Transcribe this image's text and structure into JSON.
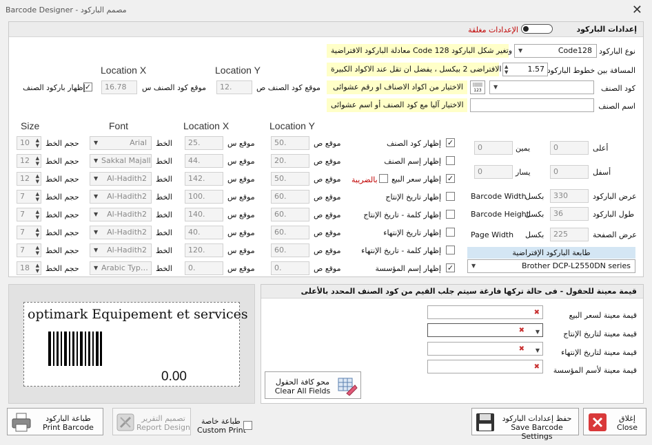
{
  "window": {
    "title": "Barcode Designer - مصمم الباركود",
    "close": "✕"
  },
  "settings": {
    "header": "إعدادات الباركود",
    "toggle_label": "الإعدادات مغلقة",
    "type_label": "نوع الباركود",
    "type_value": "Code128",
    "type_hint": "معادلة الباركود الافتراضية Code 128 وتغير شكل الباركود",
    "spacing_label": "المسافة بين خطوط الباركود",
    "spacing_value": "1.57",
    "spacing_hint": "الافتراضى 2 بيكسل ، يفضل ان تقل عند الاكواد الكبيرة",
    "code_label": "كود الصنف",
    "code_value": "",
    "code_hint": "الاختيار من اكواد الاصناف او رقم عشوائى",
    "name_label": "اسم الصنف",
    "name_value": "",
    "name_hint": "الاختيار آليا مع كود الصنف أو اسم عشوائى",
    "loc_x_head": "Location X",
    "loc_y_head": "Location Y",
    "show_code_barcode": "إظهار باركود الصنف",
    "loc_x_label": "موقع كود الصنف س",
    "loc_x_value": "16.78",
    "loc_y_label": "موقع كود الصنف ص",
    "loc_y_value": "12."
  },
  "fields": {
    "heads": {
      "size": "Size",
      "font": "Font",
      "loc_x": "Location X",
      "loc_y": "Location Y"
    },
    "lbl_size": "حجم الخط",
    "lbl_font": "الخط",
    "lbl_x": "موقع س",
    "lbl_y": "موقع ص",
    "tax_label": "بالضريبة",
    "rows": [
      {
        "label": "إظهار كود الصنف",
        "checked": "✓",
        "size": "10",
        "font": "Arial",
        "x": "25.",
        "y": "50."
      },
      {
        "label": "إظهار إسم الصنف",
        "checked": "",
        "size": "12",
        "font": "Sakkal Majalla",
        "x": "44.",
        "y": "20."
      },
      {
        "label": "إظهار سعر البيع",
        "checked": "✓",
        "size": "12",
        "font": "Al-Hadith2",
        "x": "142.",
        "y": "50."
      },
      {
        "label": "إظهار تاريخ الإنتاج",
        "checked": "",
        "size": "7",
        "font": "Al-Hadith2",
        "x": "100.",
        "y": "60."
      },
      {
        "label": "إظهار كلمة - تاريخ الإنتاج",
        "checked": "",
        "size": "7",
        "font": "Al-Hadith2",
        "x": "140.",
        "y": "60."
      },
      {
        "label": "إظهار تاريخ الإنتهاء",
        "checked": "",
        "size": "7",
        "font": "Al-Hadith2",
        "x": "40.",
        "y": "60."
      },
      {
        "label": "إظهار كلمة - تاريخ الإنتهاء",
        "checked": "",
        "size": "7",
        "font": "Al-Hadith2",
        "x": "120.",
        "y": "60."
      },
      {
        "label": "إظهار إسم المؤسسة",
        "checked": "✓",
        "size": "18",
        "font": "Arabic Typ…",
        "x": "0.",
        "y": "0."
      }
    ]
  },
  "margins": {
    "top_label": "أعلى",
    "top_value": "0",
    "right_label": "يمين",
    "right_value": "0",
    "bottom_label": "أسفل",
    "bottom_value": "0",
    "left_label": "يسار",
    "left_value": "0"
  },
  "dims": {
    "px": "بكسل",
    "width_label": "عرض الباركود",
    "width_value": "330",
    "width_en": "Barcode Width",
    "height_label": "طول الباركود",
    "height_value": "36",
    "height_en": "Barcode Height",
    "page_label": "عرض الصفحة",
    "page_value": "225",
    "page_en": "Page Width"
  },
  "printer": {
    "label": "طابعة الباركود الإفتراضية",
    "value": "Brother DCP-L2550DN series"
  },
  "preview": {
    "text": "optimark Equipement et services",
    "price": "0.00"
  },
  "defaults": {
    "header": "قيمة معينة للحقول - فى حالة تركها فارغة سيتم جلب القيم من كود الصنف المحدد بالأعلى",
    "price_label": "قيمة معينة لسعر البيع",
    "prod_label": "قيمة معينة لتاريخ الإنتاج",
    "exp_label": "قيمة معينة لتاريخ الإنتهاء",
    "org_label": "قيمة معينة لأسم المؤسسة",
    "clear_ar": "محو كافة الحقول",
    "clear_en": "Clear All Fields"
  },
  "buttons": {
    "print_ar": "طباعة الباركود",
    "print_en": "Print Barcode",
    "report_ar": "تصميم التقرير",
    "report_en": "Report Design",
    "custom_ar": "طباعة خاصة",
    "custom_en": "Custom Print",
    "save_ar": "حفظ إعدادات الباركود",
    "save_en": "Save Barcode Settings",
    "close_ar": "إغلاق",
    "close_en": "Close"
  },
  "colors": {
    "accent": "#c00000",
    "highlight": "#ffffc8",
    "printer_bar": "#d4e6f4"
  }
}
